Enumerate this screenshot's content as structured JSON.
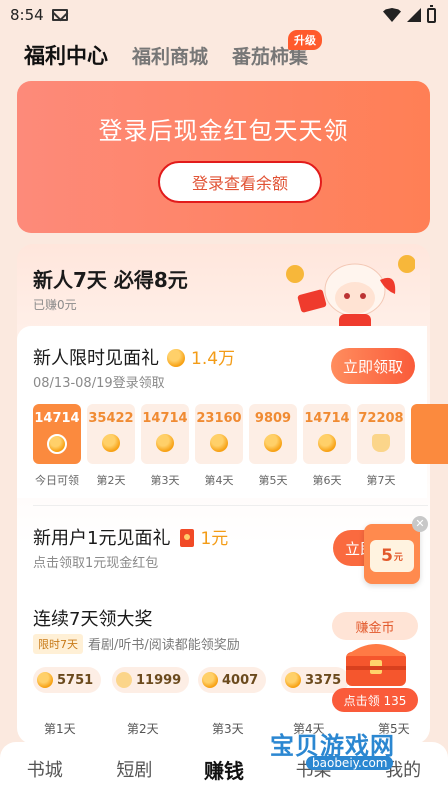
{
  "status_bar": {
    "time": "8:54"
  },
  "top_tabs": [
    {
      "label": "福利中心",
      "active": true
    },
    {
      "label": "福利商城",
      "active": false
    },
    {
      "label": "番茄柿集",
      "active": false,
      "badge": "升级"
    }
  ],
  "banner": {
    "headline": "登录后现金红包天天领",
    "button": "登录查看余额"
  },
  "newbie": {
    "title": "新人7天 必得8元",
    "earned": "已赚0元"
  },
  "task_gift": {
    "name": "新人限时见面礼",
    "amount": "1.4万",
    "date_range": "08/13-08/19登录领取",
    "button": "立即领取"
  },
  "days": [
    {
      "value": "14714",
      "label": "今日可领",
      "today": true
    },
    {
      "value": "35422",
      "label": "第2天"
    },
    {
      "value": "14714",
      "label": "第3天"
    },
    {
      "value": "23160",
      "label": "第4天"
    },
    {
      "value": "9809",
      "label": "第5天"
    },
    {
      "value": "14714",
      "label": "第6天"
    },
    {
      "value": "72208",
      "label": "第7天"
    }
  ],
  "task_one_yuan": {
    "name": "新用户1元见面礼",
    "amount": "1元",
    "desc": "点击领取1元现金红包",
    "button": "立即",
    "popup_amount": "5",
    "popup_unit": "元"
  },
  "task_streak": {
    "name": "连续7天领大奖",
    "tag": "限时7天",
    "desc": "看剧/听书/阅读都能领奖励",
    "items": [
      {
        "value": "5751",
        "label": "第1天"
      },
      {
        "value": "11999",
        "label": "第2天"
      },
      {
        "value": "4007",
        "label": "第3天"
      },
      {
        "value": "3375",
        "label": "第4天"
      }
    ],
    "last_label": "第5天",
    "chest_tag": "赚金币",
    "chest_button": "点击领 135"
  },
  "bottom_nav": [
    {
      "label": "书城"
    },
    {
      "label": "短剧"
    },
    {
      "label": "赚钱",
      "active": true
    },
    {
      "label": "书架"
    },
    {
      "label": "我的"
    }
  ],
  "watermark": {
    "text": "宝贝游戏网",
    "url": "baobeiy.com"
  }
}
